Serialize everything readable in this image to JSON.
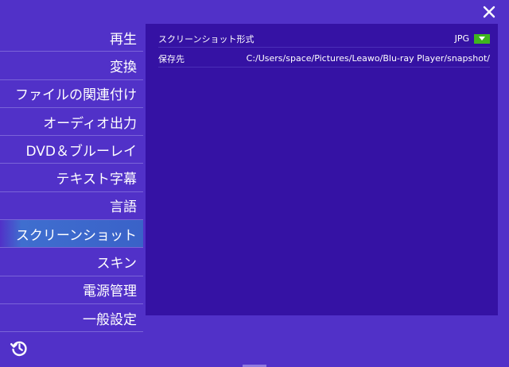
{
  "window": {
    "close_icon": "close-icon"
  },
  "sidebar": {
    "items": [
      {
        "label": "再生"
      },
      {
        "label": "変換"
      },
      {
        "label": "ファイルの関連付け"
      },
      {
        "label": "オーディオ出力"
      },
      {
        "label": "DVD＆ブルーレイ"
      },
      {
        "label": "テキスト字幕"
      },
      {
        "label": "言語"
      },
      {
        "label": "スクリーンショット",
        "active": true
      },
      {
        "label": "スキン"
      },
      {
        "label": "電源管理"
      },
      {
        "label": "一般設定"
      }
    ],
    "footer_icon": "history-icon"
  },
  "screenshot_settings": {
    "format_label": "スクリーンショット形式",
    "format_value": "JPG",
    "save_label": "保存先",
    "save_path": "C:/Users/space/Pictures/Leawo/Blu-ray Player/snapshot/"
  },
  "colors": {
    "background": "#5131c8",
    "panel": "#3512a4",
    "active_item": "#3f6ecf",
    "dropdown_accent": "#3fb51e"
  }
}
